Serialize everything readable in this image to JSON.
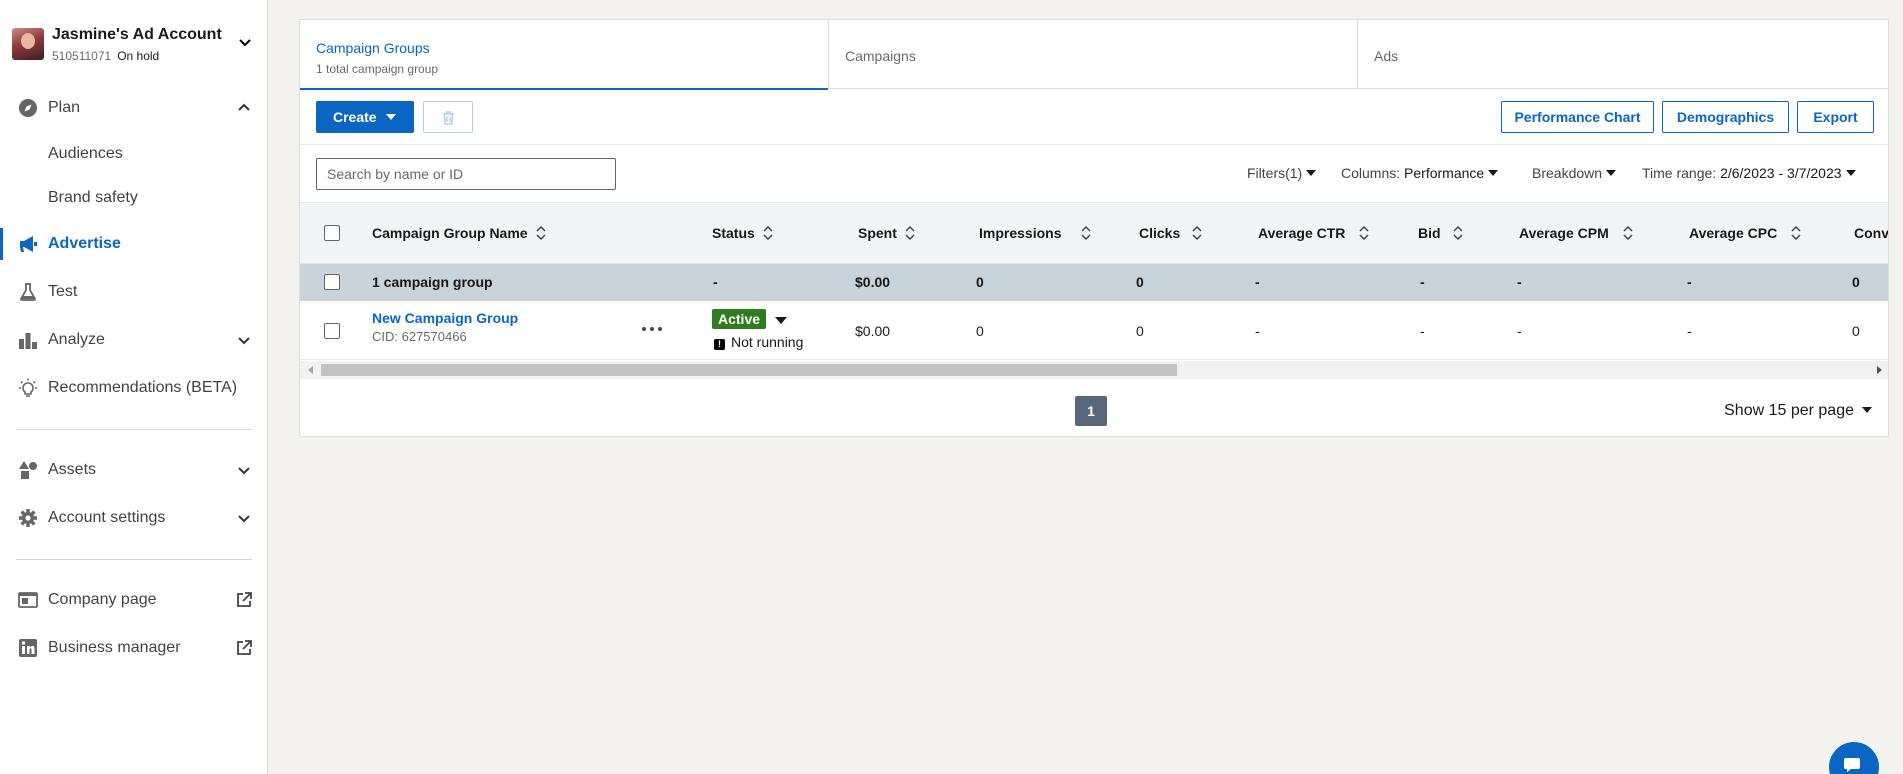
{
  "account": {
    "name": "Jasmine's Ad Account",
    "id": "510511071",
    "status": "On hold"
  },
  "sidebar": {
    "plan": "Plan",
    "audiences": "Audiences",
    "brand_safety": "Brand safety",
    "advertise": "Advertise",
    "test": "Test",
    "analyze": "Analyze",
    "recommendations": "Recommendations (BETA)",
    "assets": "Assets",
    "account_settings": "Account settings",
    "company_page": "Company page",
    "business_manager": "Business manager"
  },
  "tabs": {
    "campaign_groups": "Campaign Groups",
    "campaign_groups_count": "1 total campaign group",
    "campaigns": "Campaigns",
    "ads": "Ads"
  },
  "toolbar": {
    "create": "Create",
    "performance_chart": "Performance Chart",
    "demographics": "Demographics",
    "export": "Export"
  },
  "filters": {
    "search_placeholder": "Search by name or ID",
    "filters": "Filters(1)",
    "columns_label": "Columns:",
    "columns_value": "Performance",
    "breakdown": "Breakdown",
    "time_range_label": "Time range:",
    "time_range_value": "2/6/2023 - 3/7/2023"
  },
  "table": {
    "headers": [
      "Campaign Group Name",
      "Status",
      "Spent",
      "Impressions",
      "Clicks",
      "Average CTR",
      "Bid",
      "Average CPM",
      "Average CPC",
      "Conv"
    ],
    "summary": {
      "name": "1 campaign group",
      "status": "-",
      "spent": "$0.00",
      "impressions": "0",
      "clicks": "0",
      "ctr": "-",
      "bid": "-",
      "cpm": "-",
      "cpc": "-",
      "conv": "0"
    },
    "rows": [
      {
        "name": "New Campaign Group",
        "cid": "CID: 627570466",
        "status": "Active",
        "delivery": "Not running",
        "spent": "$0.00",
        "impressions": "0",
        "clicks": "0",
        "ctr": "-",
        "bid": "-",
        "cpm": "-",
        "cpc": "-",
        "conv": "0"
      }
    ]
  },
  "pagination": {
    "page": "1",
    "per_page": "Show 15 per page"
  },
  "colors": {
    "accent": "#0a66c2",
    "active_badge": "#2f7d1e",
    "summary_row": "#c8d3dc"
  }
}
